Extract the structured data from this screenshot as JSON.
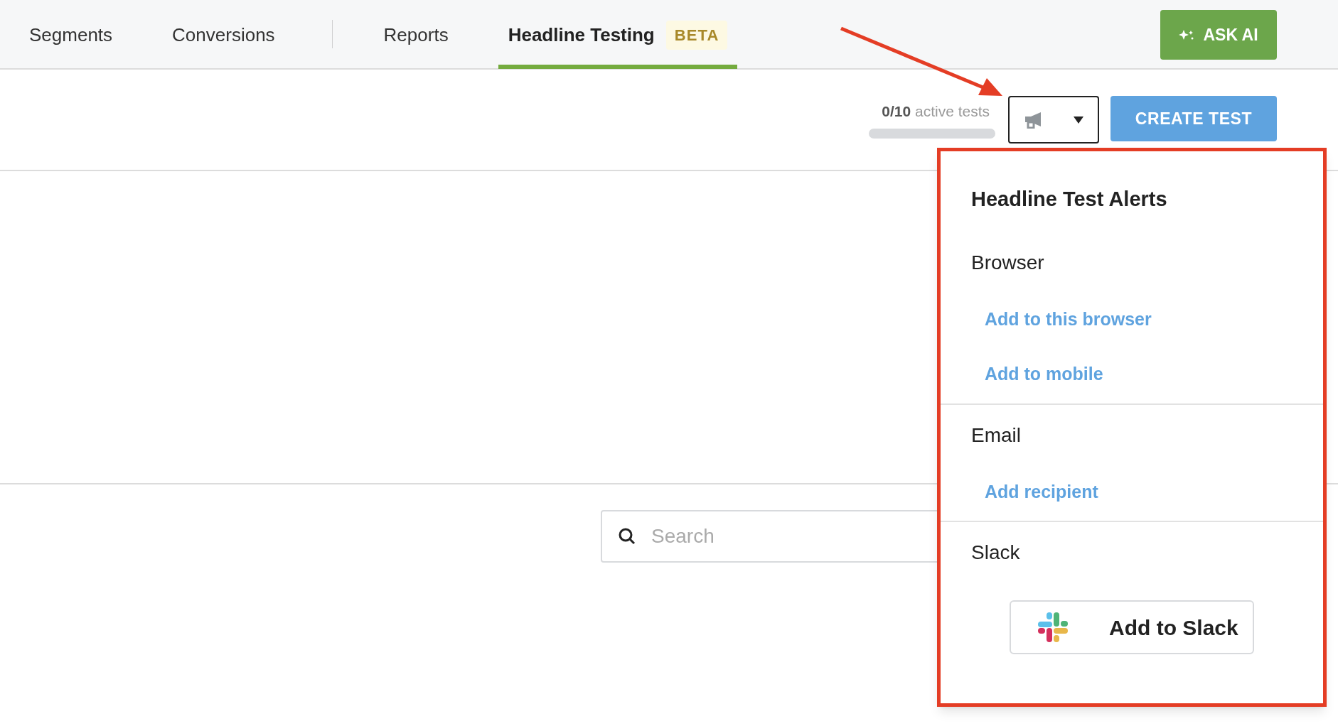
{
  "nav": {
    "tab_groups": [
      [
        {
          "label": "Segments",
          "selected": false
        },
        {
          "label": "Conversions",
          "selected": false
        }
      ],
      [
        {
          "label": "Reports",
          "selected": false
        },
        {
          "label": "Headline Testing",
          "selected": true,
          "badge": "BETA"
        }
      ]
    ],
    "ask_ai_button": "ASK AI"
  },
  "toolbar": {
    "active_tests": {
      "count": "0/10",
      "label": "active tests",
      "level": 0
    },
    "create_button": "CREATE TEST"
  },
  "search": {
    "placeholder": "Search"
  },
  "alerts_panel": {
    "title": "Headline Test Alerts",
    "sections": [
      {
        "heading": "Browser",
        "links": [
          "Add to this browser",
          "Add to mobile"
        ]
      },
      {
        "heading": "Email",
        "links": [
          "Add recipient"
        ]
      },
      {
        "heading": "Slack",
        "button": "Add to Slack"
      }
    ]
  }
}
